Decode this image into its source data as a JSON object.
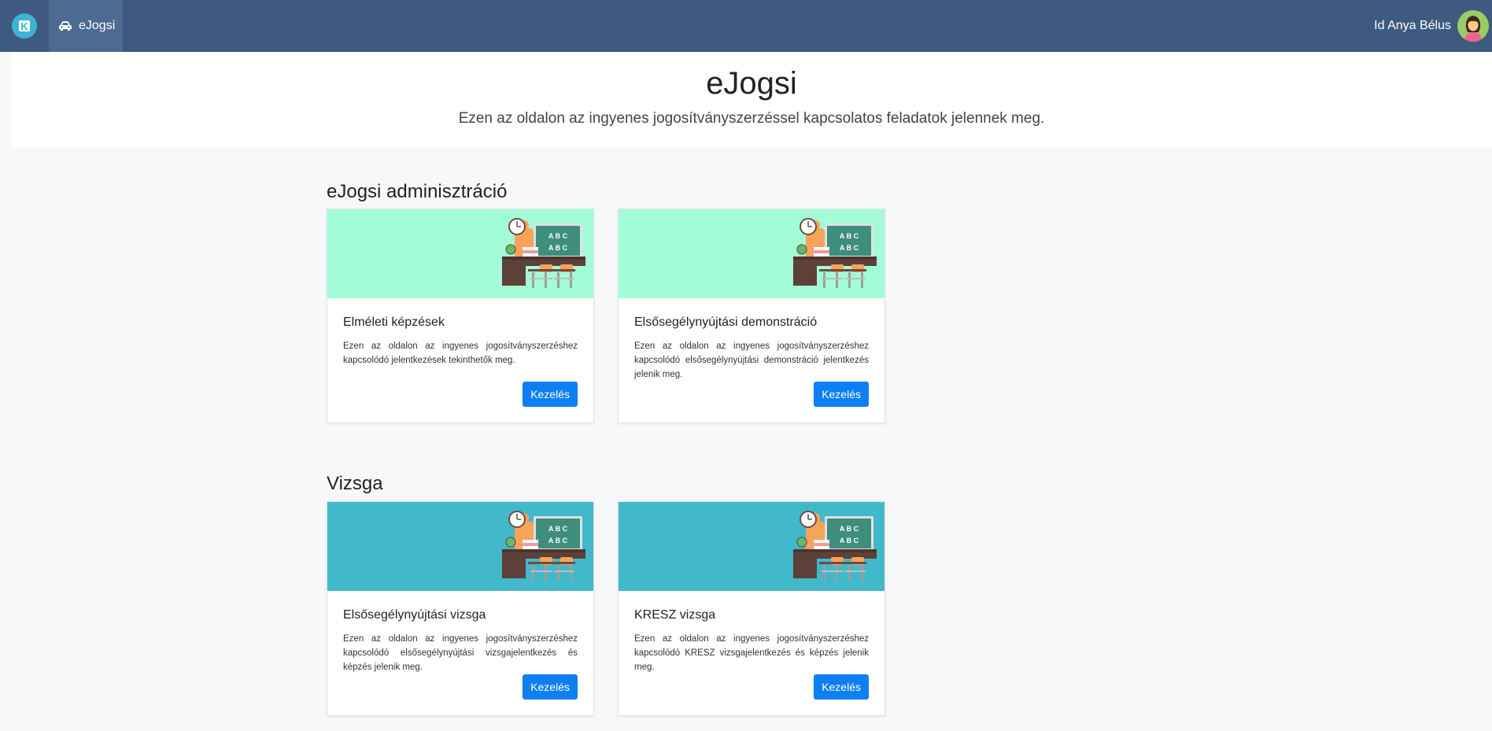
{
  "navbar": {
    "logo_letter": "K",
    "nav_item_label": "eJogsi",
    "user_name": "Id Anya Bélus"
  },
  "header": {
    "title": "eJogsi",
    "subtitle": "Ezen az oldalon az ingyenes jogosítványszerzéssel kapcsolatos feladatok jelennek meg."
  },
  "sections": [
    {
      "title": "eJogsi adminisztráció",
      "image_bg": "#a2fcd8",
      "cards": [
        {
          "title": "Elméleti képzések",
          "text": "Ezen az oldalon az ingyenes jogosítványszerzéshez kapcsolódó jelentkezések tekinthetők meg.",
          "button": "Kezelés"
        },
        {
          "title": "Elsősegélynyújtási demonstráció",
          "text": "Ezen az oldalon az ingyenes jogosítványszerzéshez kapcsolódó elsősegélynyújtási demonstráció jelentkezés jelenik meg.",
          "button": "Kezelés"
        }
      ]
    },
    {
      "title": "Vizsga",
      "image_bg": "#42b8cb",
      "cards": [
        {
          "title": "Elsősegélynyújtási vizsga",
          "text": "Ezen az oldalon az ingyenes jogosítványszerzéshez kapcsolódó elsősegélynyújtási vizsgajelentkezés és képzés jelenik meg.",
          "button": "Kezelés"
        },
        {
          "title": "KRESZ vizsga",
          "text": "Ezen az oldalon az ingyenes jogosítványszerzéshez kapcsolódó KRESZ vizsgajelentkezés és képzés jelenik meg.",
          "button": "Kezelés"
        }
      ]
    }
  ],
  "illustration": {
    "board_text_line1": "A B C",
    "board_text_line2": "A B C"
  },
  "colors": {
    "navbar": "#3e5a80",
    "nav_active": "#4d6a91",
    "button": "#0d7ff3",
    "logo": "#3fb3d3"
  }
}
